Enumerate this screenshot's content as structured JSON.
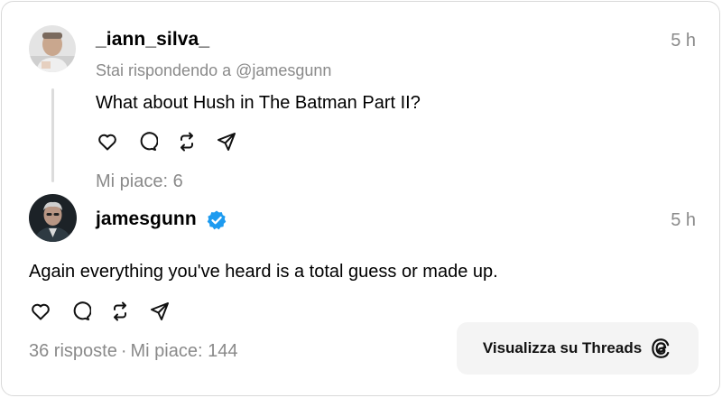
{
  "reply_post": {
    "username": "_iann_silva_",
    "time": "5 h",
    "replying_to": "Stai rispondendo a @jamesgunn",
    "text": "What about Hush in The Batman Part II?",
    "likes": "Mi piace: 6"
  },
  "main_post": {
    "username": "jamesgunn",
    "verified": true,
    "time": "5 h",
    "text": "Again everything you've heard is a total guess or made up.",
    "replies": "36 risposte",
    "separator": "·",
    "likes": "Mi piace: 144"
  },
  "open_button": {
    "label": "Visualizza su Threads"
  },
  "icons": [
    "heart-icon",
    "comment-icon",
    "repost-icon",
    "share-icon",
    "threads-logo-icon",
    "verified-badge-icon"
  ],
  "colors": {
    "verified_blue": "#1d9bf0",
    "muted_text": "#8a8a8a",
    "thread_line": "#dcdcdc",
    "button_bg": "#f4f4f4"
  }
}
